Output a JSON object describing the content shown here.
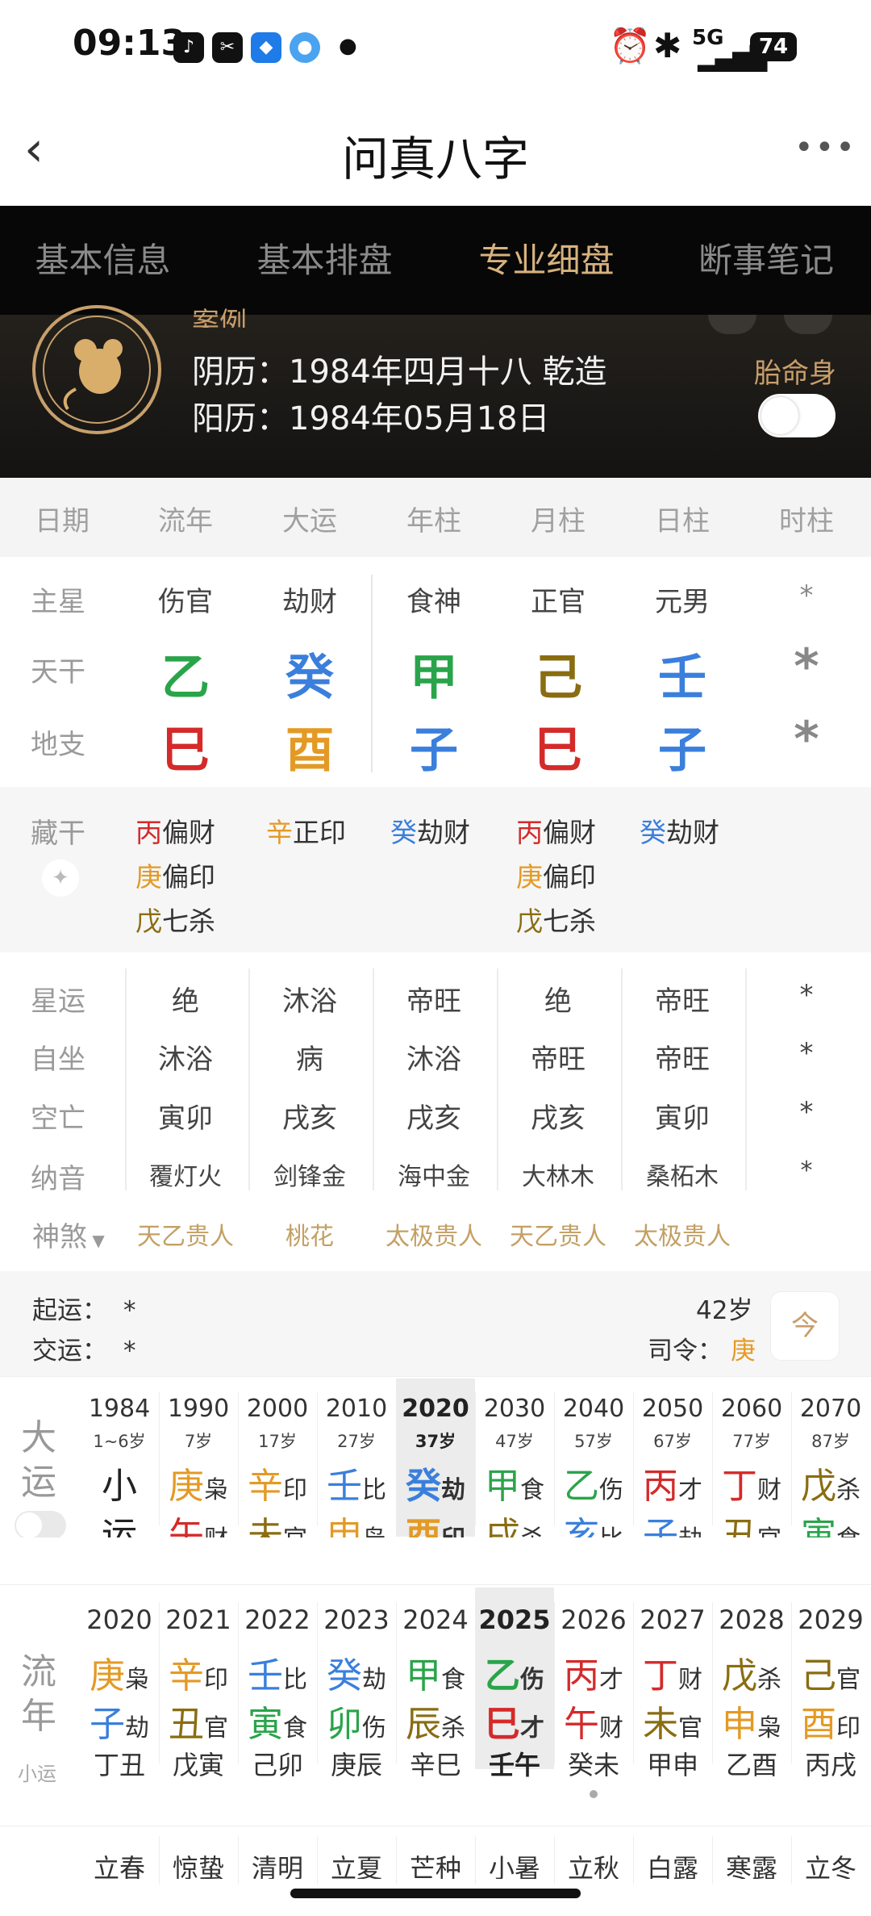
{
  "status": {
    "time": "09:13",
    "signal": "5G",
    "battery": "74"
  },
  "title": "问真八字",
  "tabs": [
    "基本信息",
    "基本排盘",
    "专业细盘",
    "断事笔记"
  ],
  "banner": {
    "name": "案例",
    "lunar": "阴历：1984年四月十八 乾造",
    "solar": "阳历：1984年05月18日",
    "taiming": "胎命身"
  },
  "headers": [
    "日期",
    "流年",
    "大运",
    "年柱",
    "月柱",
    "日柱",
    "时柱"
  ],
  "zhuxing": {
    "label": "主星",
    "values": [
      "伤官",
      "劫财",
      "食神",
      "正官",
      "元男",
      "*"
    ]
  },
  "tiangan": {
    "label": "天干",
    "values": [
      "乙",
      "癸",
      "甲",
      "己",
      "壬",
      "*"
    ]
  },
  "dizhi": {
    "label": "地支",
    "values": [
      "巳",
      "酉",
      "子",
      "巳",
      "子",
      "*"
    ]
  },
  "canggan": {
    "label": "藏干",
    "col1": [
      {
        "g": "丙",
        "s": "偏财"
      },
      {
        "g": "庚",
        "s": "偏印"
      },
      {
        "g": "戊",
        "s": "七杀"
      }
    ],
    "col2": [
      {
        "g": "辛",
        "s": "正印"
      }
    ],
    "col3": [
      {
        "g": "癸",
        "s": "劫财"
      }
    ],
    "col4": [
      {
        "g": "丙",
        "s": "偏财"
      },
      {
        "g": "庚",
        "s": "偏印"
      },
      {
        "g": "戊",
        "s": "七杀"
      }
    ],
    "col5": [
      {
        "g": "癸",
        "s": "劫财"
      }
    ]
  },
  "xingyun": {
    "label": "星运",
    "values": [
      "绝",
      "沐浴",
      "帝旺",
      "绝",
      "帝旺",
      "*"
    ]
  },
  "zizuo": {
    "label": "自坐",
    "values": [
      "沐浴",
      "病",
      "沐浴",
      "帝旺",
      "帝旺",
      "*"
    ]
  },
  "kongwang": {
    "label": "空亡",
    "values": [
      "寅卯",
      "戌亥",
      "戌亥",
      "戌亥",
      "寅卯",
      "*"
    ]
  },
  "nayin": {
    "label": "纳音",
    "values": [
      "覆灯火",
      "剑锋金",
      "海中金",
      "大林木",
      "桑柘木",
      "*"
    ]
  },
  "shensha": {
    "label": "神煞",
    "values": [
      "天乙贵人",
      "桃花",
      "太极贵人",
      "天乙贵人",
      "太极贵人"
    ]
  },
  "qiyun": {
    "qi": "起运：",
    "qi_val": "*",
    "jiao": "交运：",
    "jiao_val": "*",
    "age": "42岁",
    "siling": "司令：",
    "siling_val": "庚",
    "today": "今"
  },
  "dayun": {
    "title1": "大",
    "title2": "运",
    "cols": [
      {
        "y": "1984",
        "a": "1~6岁",
        "t1": "小",
        "t2": "运"
      },
      {
        "y": "1990",
        "a": "7岁",
        "g": "庚",
        "gs": "枭",
        "z": "午",
        "zs": "财"
      },
      {
        "y": "2000",
        "a": "17岁",
        "g": "辛",
        "gs": "印",
        "z": "未",
        "zs": "官"
      },
      {
        "y": "2010",
        "a": "27岁",
        "g": "壬",
        "gs": "比",
        "z": "申",
        "zs": "枭"
      },
      {
        "y": "2020",
        "a": "37岁",
        "g": "癸",
        "gs": "劫",
        "z": "酉",
        "zs": "印"
      },
      {
        "y": "2030",
        "a": "47岁",
        "g": "甲",
        "gs": "食",
        "z": "戌",
        "zs": "杀"
      },
      {
        "y": "2040",
        "a": "57岁",
        "g": "乙",
        "gs": "伤",
        "z": "亥",
        "zs": "比"
      },
      {
        "y": "2050",
        "a": "67岁",
        "g": "丙",
        "gs": "才",
        "z": "子",
        "zs": "劫"
      },
      {
        "y": "2060",
        "a": "77岁",
        "g": "丁",
        "gs": "财",
        "z": "丑",
        "zs": "官"
      },
      {
        "y": "2070",
        "a": "87岁",
        "g": "戊",
        "gs": "杀",
        "z": "寅",
        "zs": "食"
      }
    ]
  },
  "liunian": {
    "title1": "流",
    "title2": "年",
    "xiaoyun": "小运",
    "cols": [
      {
        "y": "2020",
        "g": "庚",
        "gs": "枭",
        "z": "子",
        "zs": "劫",
        "x": "丁丑"
      },
      {
        "y": "2021",
        "g": "辛",
        "gs": "印",
        "z": "丑",
        "zs": "官",
        "x": "戊寅"
      },
      {
        "y": "2022",
        "g": "壬",
        "gs": "比",
        "z": "寅",
        "zs": "食",
        "x": "己卯"
      },
      {
        "y": "2023",
        "g": "癸",
        "gs": "劫",
        "z": "卯",
        "zs": "伤",
        "x": "庚辰"
      },
      {
        "y": "2024",
        "g": "甲",
        "gs": "食",
        "z": "辰",
        "zs": "杀",
        "x": "辛巳"
      },
      {
        "y": "2025",
        "g": "乙",
        "gs": "伤",
        "z": "巳",
        "zs": "才",
        "x": "壬午"
      },
      {
        "y": "2026",
        "g": "丙",
        "gs": "才",
        "z": "午",
        "zs": "财",
        "x": "癸未"
      },
      {
        "y": "2027",
        "g": "丁",
        "gs": "财",
        "z": "未",
        "zs": "官",
        "x": "甲申"
      },
      {
        "y": "2028",
        "g": "戊",
        "gs": "杀",
        "z": "申",
        "zs": "枭",
        "x": "乙酉"
      },
      {
        "y": "2029",
        "g": "己",
        "gs": "官",
        "z": "酉",
        "zs": "印",
        "x": "丙戌"
      }
    ]
  },
  "jieqi": [
    "立春",
    "惊蛰",
    "清明",
    "立夏",
    "芒种",
    "小暑",
    "立秋",
    "白露",
    "寒露",
    "立冬"
  ]
}
